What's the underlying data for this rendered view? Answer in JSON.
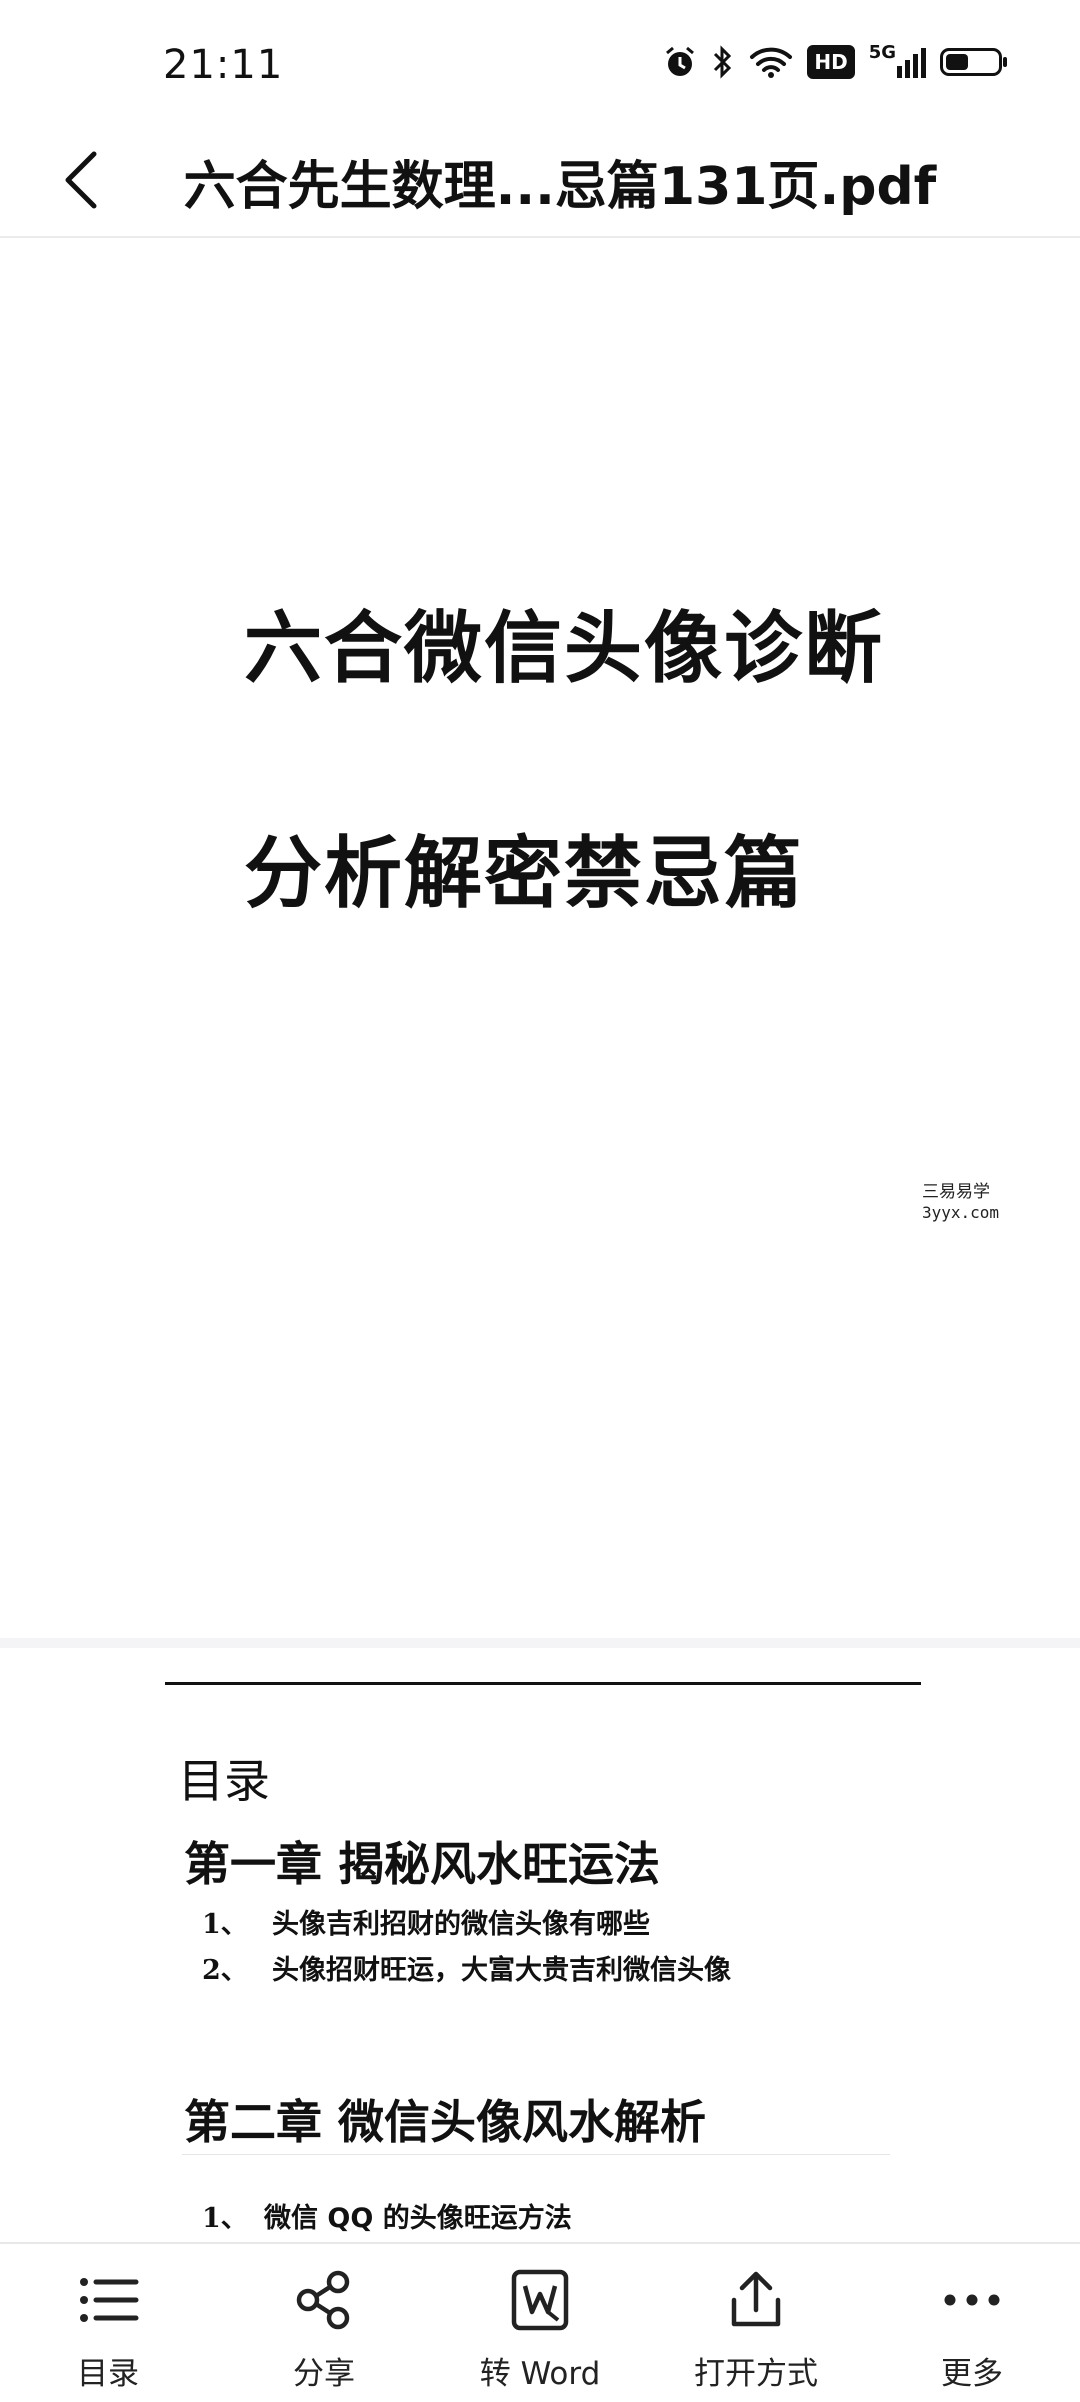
{
  "status_bar": {
    "time": "21:11",
    "network": "5G",
    "hd": "HD",
    "icons": [
      "alarm-icon",
      "bluetooth-icon",
      "wifi-icon",
      "hd-icon",
      "signal-5g-icon",
      "battery-icon"
    ],
    "battery_level": 0.4
  },
  "header": {
    "back_icon": "chevron-left-icon",
    "title": "六合先生数理...忌篇131页.pdf"
  },
  "document": {
    "cover": {
      "line1": "六合微信头像诊断",
      "line2": "分析解密禁忌篇",
      "watermark_line1": "三易易学",
      "watermark_line2": "3yyx.com"
    },
    "toc": {
      "title": "目录",
      "chapter1": {
        "title": "第一章  揭秘风水旺运法",
        "items": [
          {
            "num": "1、",
            "text": "头像吉利招财的微信头像有哪些"
          },
          {
            "num": "2、",
            "text": "头像招财旺运，大富大贵吉利微信头像"
          }
        ]
      },
      "chapter2": {
        "title": "第二章  微信头像风水解析",
        "items": [
          {
            "num": "1、",
            "text": "微信 QQ 的头像旺运方法"
          }
        ]
      }
    }
  },
  "toolbar": {
    "items": [
      {
        "label": "目录",
        "icon": "list-icon"
      },
      {
        "label": "分享",
        "icon": "share-icon"
      },
      {
        "label": "转 Word",
        "icon": "word-convert-icon"
      },
      {
        "label": "打开方式",
        "icon": "open-with-icon"
      },
      {
        "label": "更多",
        "icon": "more-icon"
      }
    ]
  }
}
